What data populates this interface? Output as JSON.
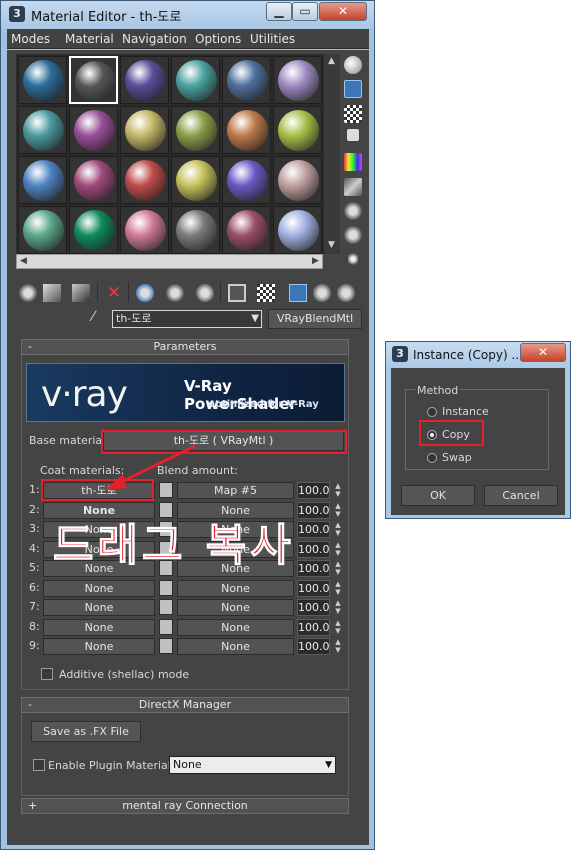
{
  "window": {
    "title": "Material Editor - th-도로",
    "app_icon": "3",
    "minimize": "▁",
    "maximize": "▭",
    "close": "✕"
  },
  "menu": [
    "Modes",
    "Material",
    "Navigation",
    "Options",
    "Utilities"
  ],
  "slots": {
    "colors": [
      "#2d6d9b",
      "#555555",
      "#5a4e9a",
      "#4aa3a0",
      "#4f6f9e",
      "#a08cc2",
      "#4c9aa0",
      "#9a4e9a",
      "#c4b868",
      "#8aa04a",
      "#c07a4a",
      "#a8c04a",
      "#4f83c2",
      "#a04a7a",
      "#c04a4a",
      "#c4c25a",
      "#6a5ac2",
      "#c0a0a0",
      "#5aa88a",
      "#0e8a5a",
      "#d07a98",
      "#7a7a7a",
      "#9a4e6a",
      "#a0b0e0"
    ],
    "selected_index": 1
  },
  "material_name": "th-도로",
  "material_type": "VRayBlendMtl",
  "parameters": {
    "header_sign": "-",
    "header": "Parameters",
    "banner_logo": "v·ray",
    "banner_title": "V-Ray PowerShader",
    "banner_subtitle": "optimized for V-Ray",
    "base_label": "Base material:",
    "base_value": "th-도로  ( VRayMtl )",
    "coat_label": "Coat materials:",
    "blend_label": "Blend amount:",
    "rows": [
      {
        "num": "1:",
        "coat": "th-도로",
        "map": "Map #5",
        "amount": "100.0"
      },
      {
        "num": "2:",
        "coat": "None",
        "map": "None",
        "amount": "100.0"
      },
      {
        "num": "3:",
        "coat": "None",
        "map": "None",
        "amount": "100.0"
      },
      {
        "num": "4:",
        "coat": "None",
        "map": "None",
        "amount": "100.0"
      },
      {
        "num": "5:",
        "coat": "None",
        "map": "None",
        "amount": "100.0"
      },
      {
        "num": "6:",
        "coat": "None",
        "map": "None",
        "amount": "100.0"
      },
      {
        "num": "7:",
        "coat": "None",
        "map": "None",
        "amount": "100.0"
      },
      {
        "num": "8:",
        "coat": "None",
        "map": "None",
        "amount": "100.0"
      },
      {
        "num": "9:",
        "coat": "None",
        "map": "None",
        "amount": "100.0"
      }
    ],
    "additive_label": "Additive (shellac) mode"
  },
  "directx": {
    "header_sign": "-",
    "header": "DirectX Manager",
    "save_fx": "Save as .FX File",
    "enable_plugin": "Enable Plugin Material",
    "plugin_select": "None"
  },
  "mentalray": {
    "header_sign": "+",
    "header": "mental ray Connection"
  },
  "annotation": "드래그 복사",
  "dialog": {
    "title": "Instance (Copy) ...",
    "app_icon": "3",
    "close": "✕",
    "group_label": "Method",
    "options": [
      "Instance",
      "Copy",
      "Swap"
    ],
    "selected": "Copy",
    "ok": "OK",
    "cancel": "Cancel"
  },
  "accent_red": "#e3202b"
}
